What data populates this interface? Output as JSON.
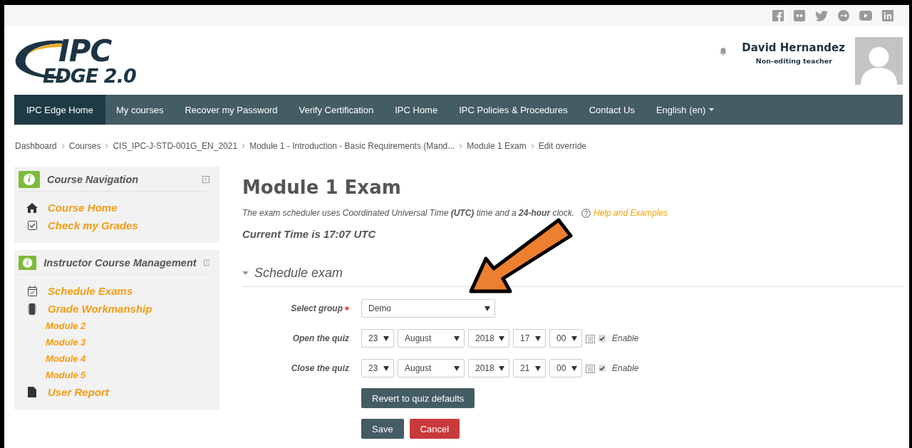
{
  "logo": {
    "line1": "IPC",
    "line2": "EDGE 2.0"
  },
  "user": {
    "name": "David Hernandez",
    "role": "Non-editing teacher"
  },
  "nav": [
    {
      "label": "IPC Edge Home",
      "selected": true,
      "kind": "link"
    },
    {
      "label": "My courses",
      "selected": false,
      "kind": "link"
    },
    {
      "label": "Recover my Password",
      "selected": false,
      "kind": "link"
    },
    {
      "label": "Verify Certification",
      "selected": false,
      "kind": "link"
    },
    {
      "label": "IPC Home",
      "selected": false,
      "kind": "link"
    },
    {
      "label": "IPC Policies & Procedures",
      "selected": false,
      "kind": "link"
    },
    {
      "label": "Contact Us",
      "selected": false,
      "kind": "link"
    },
    {
      "label": "English (en)",
      "selected": false,
      "kind": "dropdown"
    }
  ],
  "breadcrumb": [
    "Dashboard",
    "Courses",
    "CIS_IPC-J-STD-001G_EN_2021",
    "Module 1 - Introduction - Basic Requirements (Mand...",
    "Module 1 Exam",
    "Edit override"
  ],
  "sidebar": [
    {
      "title": "Course Navigation",
      "items": [
        {
          "label": "Course Home",
          "kind": "home"
        },
        {
          "label": "Check my Grades",
          "kind": "check"
        }
      ]
    },
    {
      "title": "Instructor Course Management",
      "items": [
        {
          "label": "Schedule Exams",
          "kind": "calendar"
        },
        {
          "label": "Grade Workmanship",
          "kind": "chip",
          "children": [
            {
              "label": "Module 2",
              "kind": "sub"
            },
            {
              "label": "Module 3",
              "kind": "sub"
            },
            {
              "label": "Module 4",
              "kind": "sub"
            },
            {
              "label": "Module 5",
              "kind": "sub"
            }
          ]
        },
        {
          "label": "User Report",
          "kind": "file"
        }
      ]
    }
  ],
  "page": {
    "title": "Module 1 Exam",
    "note": "The exam scheduler uses Coordinated Universal Time **(UTC)** time and a **24-hour** clock.",
    "help_link": "Help and Examples",
    "current_time": "Current Time is 17:07 UTC"
  },
  "form": {
    "section": "Schedule exam",
    "expanded": true,
    "group": {
      "label": "Select group",
      "required": true,
      "value": "Demo"
    },
    "dates": [
      {
        "label": "Open the quiz",
        "fields": [
          "23",
          "August",
          "2018",
          "17",
          "00"
        ],
        "enable_label": "Enable",
        "checked": true
      },
      {
        "label": "Close the quiz",
        "fields": [
          "23",
          "August",
          "2018",
          "21",
          "00"
        ],
        "enable_label": "Enable",
        "checked": true
      }
    ],
    "revert_button": "Revert to quiz defaults",
    "save_button": "Save",
    "cancel_button": "Cancel"
  }
}
